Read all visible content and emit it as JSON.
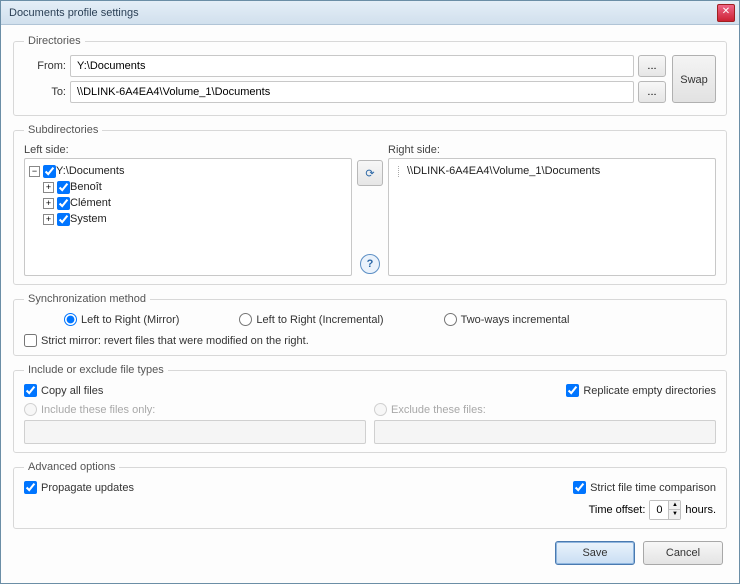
{
  "title": "Documents profile settings",
  "directories": {
    "legend": "Directories",
    "from_label": "From:",
    "to_label": "To:",
    "from_value": "Y:\\Documents",
    "to_value": "\\\\DLINK-6A4EA4\\Volume_1\\Documents",
    "browse": "...",
    "swap": "Swap"
  },
  "subdirs": {
    "legend": "Subdirectories",
    "left_label": "Left side:",
    "right_label": "Right side:",
    "left_root": "Y:\\Documents",
    "left_children": [
      "Benoît",
      "Clément",
      "System"
    ],
    "right_root": "\\\\DLINK-6A4EA4\\Volume_1\\Documents"
  },
  "sync": {
    "legend": "Synchronization method",
    "opt1": "Left to Right (Mirror)",
    "opt2": "Left to Right (Incremental)",
    "opt3": "Two-ways incremental",
    "strict_label": "Strict mirror: revert files that were modified on the right."
  },
  "inc": {
    "legend": "Include or exclude file types",
    "copy_all": "Copy all files",
    "replicate": "Replicate empty directories",
    "include_only": "Include these files only:",
    "exclude": "Exclude these files:"
  },
  "adv": {
    "legend": "Advanced options",
    "propagate": "Propagate updates",
    "strict_time": "Strict file time comparison",
    "time_offset_label": "Time offset:",
    "time_offset_value": "0",
    "hours": "hours."
  },
  "buttons": {
    "save": "Save",
    "cancel": "Cancel"
  }
}
